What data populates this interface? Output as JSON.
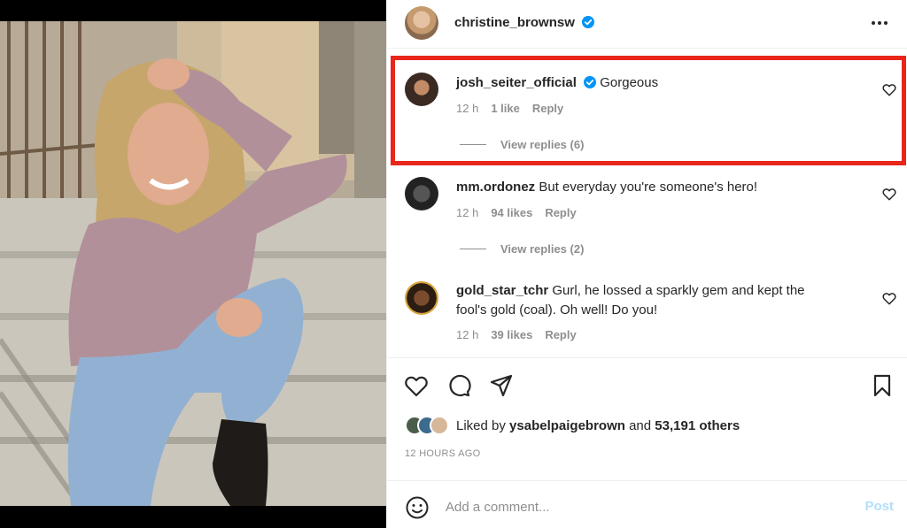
{
  "post": {
    "author": "christine_brownsw",
    "author_verified": true,
    "more_icon": "more-horizontal-icon"
  },
  "comments": [
    {
      "username": "josh_seiter_official",
      "verified": true,
      "text": "Gorgeous",
      "time": "12 h",
      "likes": "1 like",
      "reply": "Reply",
      "view_replies": "View replies (6)"
    },
    {
      "username": "mm.ordonez",
      "verified": false,
      "text": "But everyday you're someone's hero!",
      "time": "12 h",
      "likes": "94 likes",
      "reply": "Reply",
      "view_replies": "View replies (2)"
    },
    {
      "username": "gold_star_tchr",
      "verified": false,
      "text": "Gurl, he lossed a sparkly gem and kept the fool's gold (coal). Oh well! Do you!",
      "time": "12 h",
      "likes": "39 likes",
      "reply": "Reply"
    }
  ],
  "actions": {
    "icons": [
      "heart-icon",
      "comment-icon",
      "share-icon",
      "bookmark-icon"
    ]
  },
  "likes_summary": {
    "prefix": "Liked by",
    "user": "ysabelpaigebrown",
    "conjunction": "and",
    "others": "53,191 others"
  },
  "timestamp": "12 HOURS AGO",
  "comment_box": {
    "placeholder": "Add a comment...",
    "post_label": "Post"
  },
  "colors": {
    "highlight": "#e8261a",
    "verified": "#0095f6",
    "post_disabled": "#b2dffc"
  }
}
